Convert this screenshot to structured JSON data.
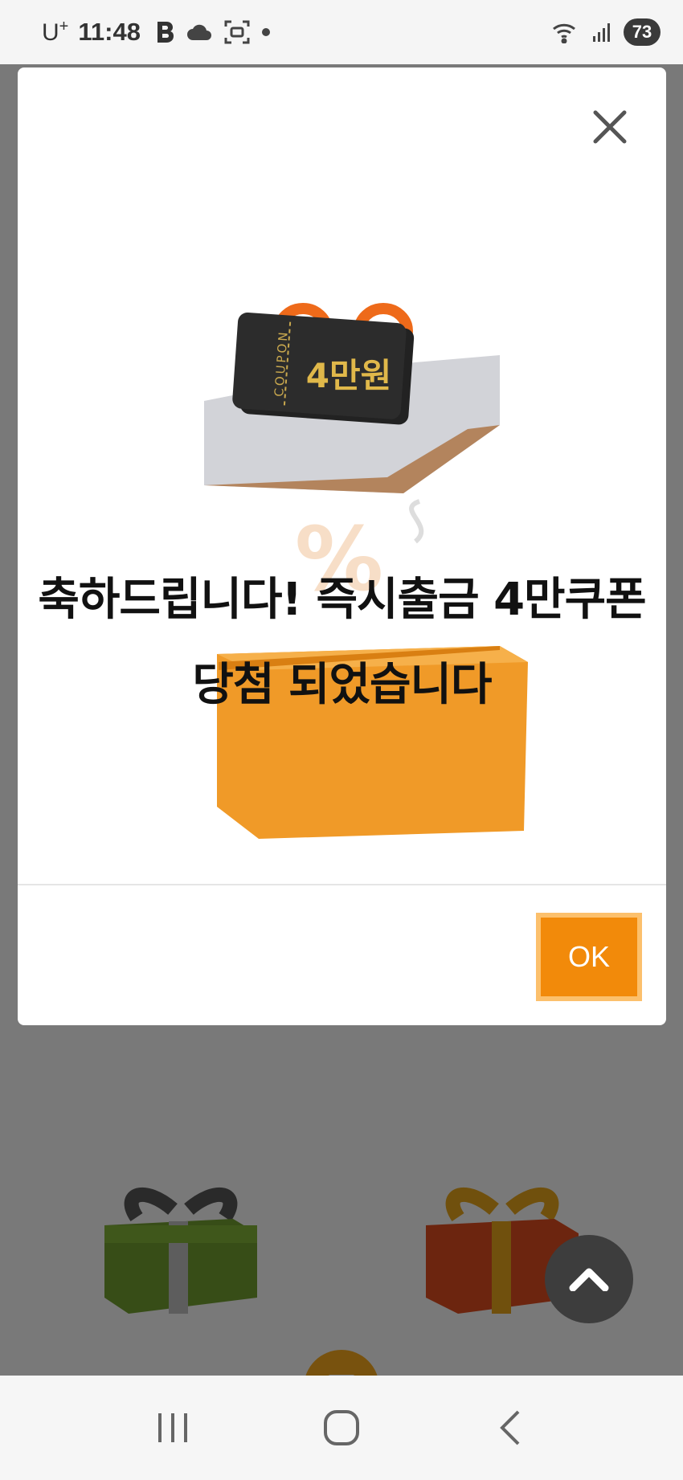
{
  "status_bar": {
    "carrier": "U",
    "carrier_sup": "+",
    "time": "11:48",
    "battery": "73",
    "icons": [
      "b-app-icon",
      "cloud-icon",
      "screenshot-icon",
      "dot-icon",
      "wifi-icon",
      "signal-icon",
      "battery-icon"
    ]
  },
  "modal": {
    "coupon_label": "COUPON",
    "coupon_amount": "4만원",
    "headline_line1": "축하드립니다! 즉시출금 4만쿠폰",
    "headline_line2": "당첨 되었습니다",
    "ok_label": "OK",
    "close_icon": "close-icon",
    "accent_color": "#f28a0a",
    "ok_border_color": "#fcc06c"
  },
  "background": {
    "gift_colors": [
      "#6f9a2f",
      "#d94a1f"
    ],
    "menu_fab_color": "#f0a51d"
  },
  "nav_bar": {
    "icons": [
      "recent-apps-icon",
      "home-icon",
      "back-icon"
    ]
  }
}
